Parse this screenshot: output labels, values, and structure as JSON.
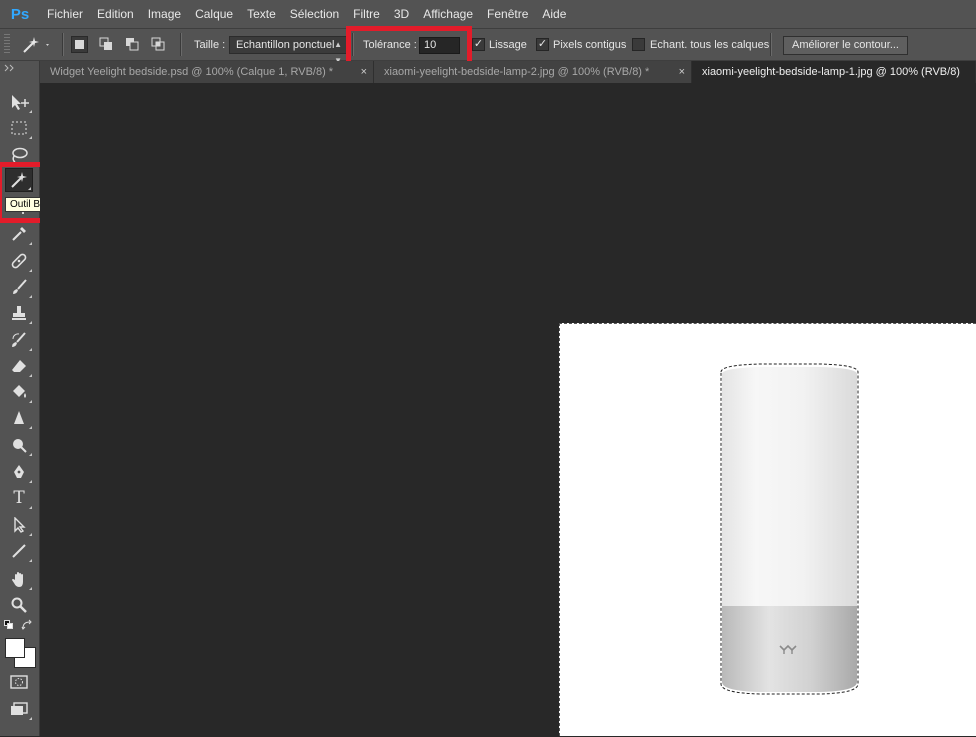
{
  "app": {
    "logo": "Ps"
  },
  "menu": [
    "Fichier",
    "Edition",
    "Image",
    "Calque",
    "Texte",
    "Sélection",
    "Filtre",
    "3D",
    "Affichage",
    "Fenêtre",
    "Aide"
  ],
  "options": {
    "taille_label": "Taille :",
    "taille_value": "Echantillon ponctuel",
    "tolerance_label": "Tolérance :",
    "tolerance_value": "10",
    "lissage_label": "Lissage",
    "lissage_checked": true,
    "contigus_label": "Pixels contigus",
    "contigus_checked": true,
    "echant_label": "Echant. tous les calques",
    "echant_checked": false,
    "refine_label": "Améliorer le contour..."
  },
  "tabs": [
    {
      "label": "Widget Yeelight bedside.psd @ 100% (Calque 1, RVB/8) *",
      "active": false
    },
    {
      "label": "xiaomi-yeelight-bedside-lamp-2.jpg @ 100% (RVB/8) *",
      "active": false
    },
    {
      "label": "xiaomi-yeelight-bedside-lamp-1.jpg @ 100% (RVB/8)",
      "active": true
    }
  ],
  "tab_close_glyph": "×",
  "tooltip": "Outil Baguette magique (W)",
  "tools": [
    "move-icon",
    "marquee-icon",
    "lasso-icon",
    "magic-wand-icon",
    "crop-icon",
    "eyedropper-icon",
    "healing-brush-icon",
    "brush-icon",
    "clone-stamp-icon",
    "history-brush-icon",
    "eraser-icon",
    "paint-bucket-icon",
    "blur-icon",
    "dodge-icon",
    "pen-icon",
    "type-icon",
    "path-selection-icon",
    "line-icon",
    "hand-icon",
    "zoom-icon"
  ],
  "type_tool_glyph": "T",
  "colors": {
    "highlight": "#e31c2a",
    "foreground": "#ffffff",
    "background": "#ffffff"
  }
}
